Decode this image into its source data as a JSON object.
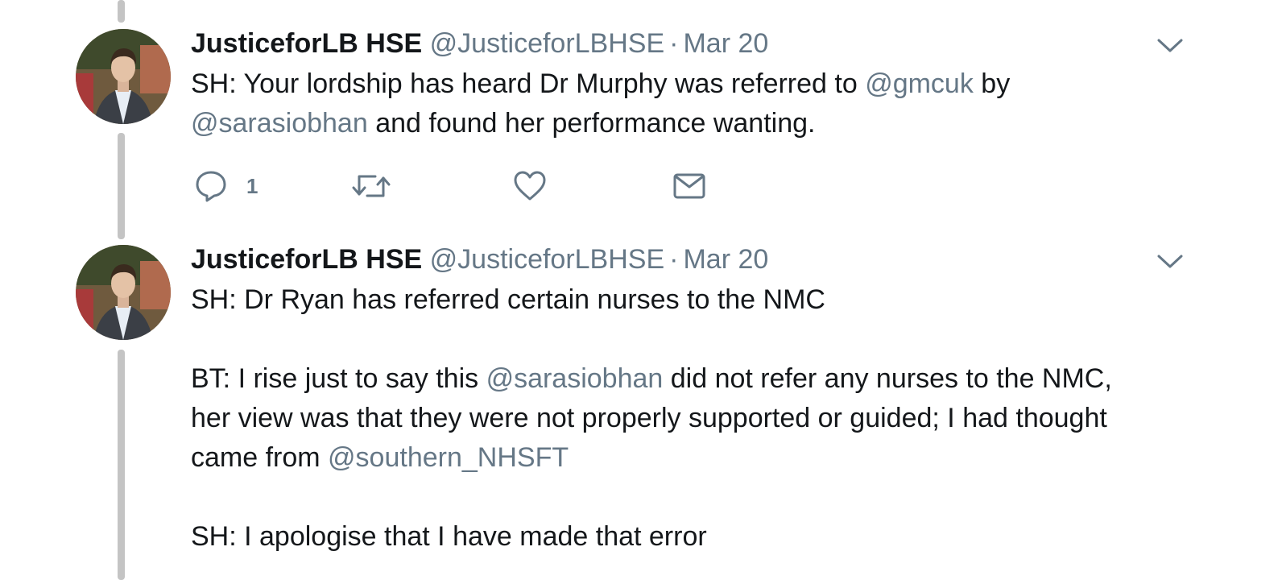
{
  "tweets": [
    {
      "name": "JusticeforLB HSE",
      "handle": "@JusticeforLBHSE",
      "separator": "·",
      "time": "Mar 20",
      "text": {
        "line1_a": "SH: Your lordship has heard Dr Murphy was referred to ",
        "line1_mention": "@gmcuk",
        "line1_b": " by",
        "line2_mention": "@sarasiobhan",
        "line2_b": " and found her performance wanting."
      },
      "actions": {
        "reply_count": "1",
        "icons": [
          "reply-icon",
          "retweet-icon",
          "like-icon",
          "message-icon"
        ]
      }
    },
    {
      "name": "JusticeforLB HSE",
      "handle": "@JusticeforLBHSE",
      "separator": "·",
      "time": "Mar 20",
      "text": {
        "p1": "SH: Dr Ryan has referred certain nurses to the NMC",
        "p2_line1_a": "BT: I rise just to say this ",
        "p2_line1_mention": "@sarasiobhan",
        "p2_line1_b": " did not refer any nurses to the NMC,",
        "p2_line2": "her view was that they were not properly supported or guided; I had thought",
        "p2_line3_a": "came from ",
        "p2_line3_mention": "@southern_NHSFT",
        "p3": "SH: I apologise that I have made that error"
      }
    }
  ],
  "colors": {
    "text": "#14171a",
    "muted": "#657786",
    "thread_line": "#c4c4c4"
  }
}
